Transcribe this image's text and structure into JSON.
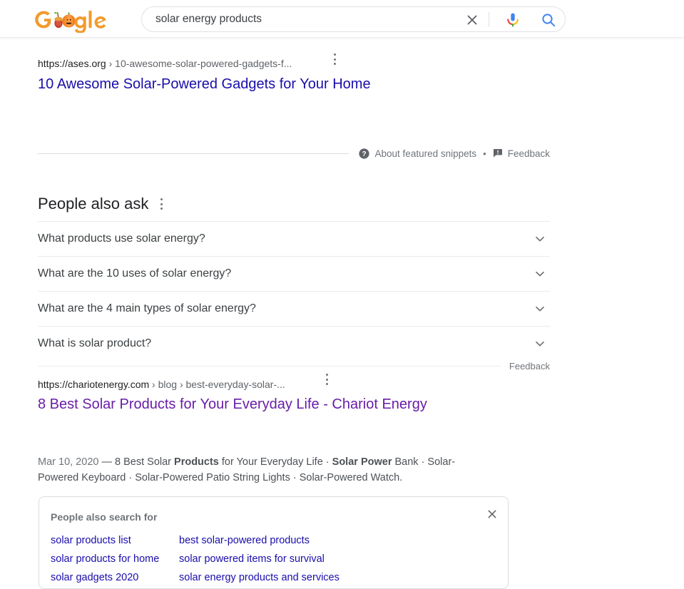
{
  "header": {
    "logo": {
      "name": "google-halloween-doodle",
      "letters": [
        "G",
        "o",
        "o",
        "g",
        "l",
        "e"
      ],
      "colors": {
        "orange": "#F39A2B",
        "orange_dark": "#E8761B",
        "pumpkin": "#F08020",
        "acorn": "#C0392B",
        "leaf": "#7CB342"
      }
    },
    "search": {
      "value": "solar energy products",
      "placeholder": "Search",
      "clear_icon": "close-icon",
      "mic_icon": "microphone-icon",
      "search_icon": "search-icon"
    }
  },
  "featured_snippet": {
    "url_domain": "https://ases.org",
    "url_path": "› 10-awesome-solar-powered-gadgets-f...",
    "title": "10 Awesome Solar-Powered Gadgets for Your Home",
    "about_label": "About featured snippets",
    "separator": "•",
    "feedback_label": "Feedback",
    "help_icon": "help-circle-icon",
    "feedback_icon": "feedback-flag-icon",
    "kebab_icon": "more-options-icon"
  },
  "people_also_ask": {
    "heading": "People also ask",
    "kebab_icon": "more-options-icon",
    "questions": [
      {
        "text": "What products use solar energy?",
        "chevron": "chevron-down-icon"
      },
      {
        "text": "What are the 10 uses of solar energy?",
        "chevron": "chevron-down-icon"
      },
      {
        "text": "What are the 4 main types of solar energy?",
        "chevron": "chevron-down-icon"
      },
      {
        "text": "What is solar product?",
        "chevron": "chevron-down-icon"
      }
    ],
    "feedback_label": "Feedback"
  },
  "result_2": {
    "url_domain": "https://chariotenergy.com",
    "url_path": "› blog › best-everyday-solar-...",
    "title": "8 Best Solar Products for Your Everyday Life - Chariot Energy",
    "kebab_icon": "more-options-icon",
    "snippet": {
      "date": "Mar 10, 2020",
      "dash": "—",
      "parts": [
        {
          "text": " 8 Best Solar ",
          "bold": false
        },
        {
          "text": "Products",
          "bold": true
        },
        {
          "text": " for Your Everyday Life · ",
          "bold": false
        },
        {
          "text": "Solar Power",
          "bold": true
        },
        {
          "text": " Bank · Solar-Powered Keyboard · Solar-Powered Patio String Lights · Solar-Powered Watch.",
          "bold": false
        }
      ]
    }
  },
  "people_also_search_for": {
    "title": "People also search for",
    "close_icon": "close-icon",
    "links": [
      "solar products list",
      "best solar-powered products",
      "solar products for home",
      "solar powered items for survival",
      "solar gadgets 2020",
      "solar energy products and services"
    ]
  },
  "colors": {
    "link_blue": "#1a0dab",
    "link_visited_purple": "#681da8",
    "text_dark": "#202124",
    "text_gray": "#70757a",
    "snippet_gray": "#4d5156",
    "border_gray": "#dadce0"
  }
}
